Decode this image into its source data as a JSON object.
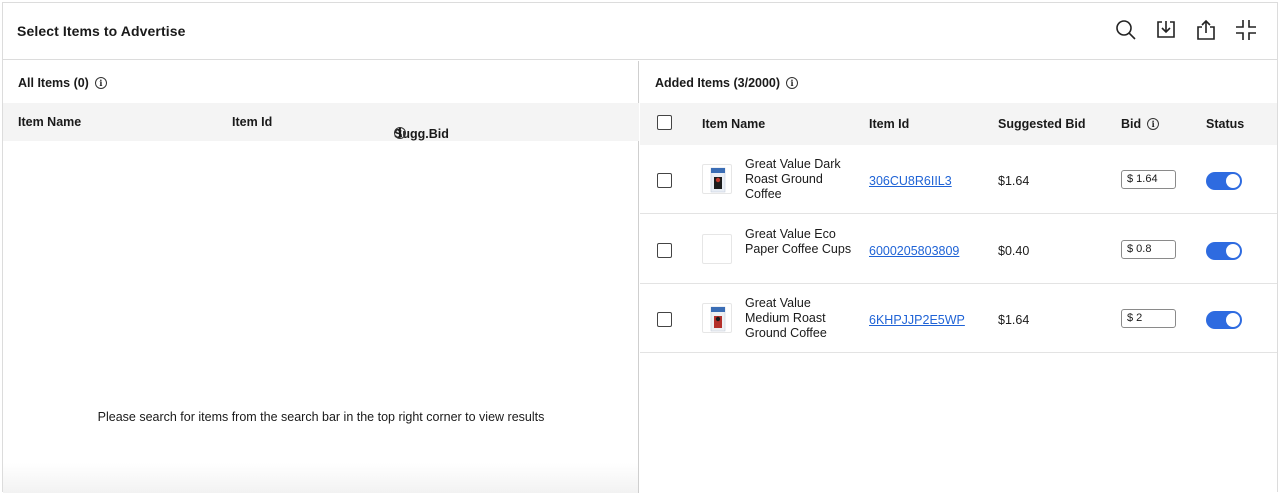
{
  "header": {
    "title": "Select Items to Advertise",
    "icons": [
      "search-icon",
      "download-icon",
      "share-icon",
      "collapse-icon"
    ]
  },
  "left_panel": {
    "title": "All Items (0)",
    "columns": [
      "Item Name",
      "Item Id",
      "Sugg.Bid"
    ],
    "empty_message": "Please search for items from the search bar in the top right corner to view results"
  },
  "right_panel": {
    "title": "Added Items (3/2000)",
    "columns": {
      "name": "Item Name",
      "id": "Item Id",
      "suggested": "Suggested Bid",
      "bid": "Bid",
      "status": "Status"
    },
    "rows": [
      {
        "name": "Great Value Dark Roast Ground Coffee",
        "id": "306CU8R6IIL3",
        "suggested": "$1.64",
        "bid": "$ 1.64",
        "status": "on",
        "thumb": "coffee-bag"
      },
      {
        "name": "Great Value Eco Paper Coffee Cups",
        "id": "6000205803809",
        "suggested": "$0.40",
        "bid": "$ 0.8",
        "status": "on",
        "thumb": "blank"
      },
      {
        "name": "Great Value Medium Roast Ground Coffee",
        "id": "6KHPJJP2E5WP",
        "suggested": "$1.64",
        "bid": "$ 2",
        "status": "on",
        "thumb": "coffee-bag-red"
      }
    ]
  },
  "colors": {
    "accent": "#2e6be0",
    "link": "#1f63d6",
    "header_bg": "#f4f4f4"
  }
}
